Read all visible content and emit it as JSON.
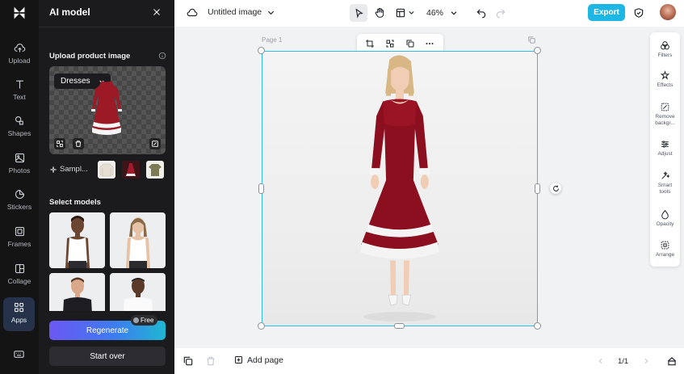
{
  "rail": {
    "items": [
      {
        "label": "Upload",
        "icon": "cloud-upload-icon"
      },
      {
        "label": "Text",
        "icon": "text-icon"
      },
      {
        "label": "Shapes",
        "icon": "shapes-icon"
      },
      {
        "label": "Photos",
        "icon": "photos-icon"
      },
      {
        "label": "Stickers",
        "icon": "stickers-icon"
      },
      {
        "label": "Frames",
        "icon": "frames-icon"
      },
      {
        "label": "Collage",
        "icon": "collage-icon"
      },
      {
        "label": "Apps",
        "icon": "apps-icon",
        "active": true
      }
    ]
  },
  "panel": {
    "title": "AI model",
    "upload_label": "Upload product image",
    "category_select": "Dresses",
    "samples_label": "Sampl...",
    "models_label": "Select models",
    "regenerate_label": "Regenerate",
    "free_badge": "Free",
    "start_over_label": "Start over"
  },
  "topbar": {
    "doc_title": "Untitled image",
    "zoom": "46%",
    "export_label": "Export"
  },
  "canvas": {
    "page_label": "Page 1"
  },
  "right_tools": [
    {
      "label": "Filters",
      "icon": "filters-icon"
    },
    {
      "label": "Effects",
      "icon": "effects-icon"
    },
    {
      "label": "Remove",
      "label2": "backgr...",
      "icon": "remove-background-icon"
    },
    {
      "label": "Adjust",
      "icon": "adjust-icon"
    },
    {
      "label": "Smart",
      "label2": "tools",
      "icon": "smart-tools-icon"
    },
    {
      "label": "Opacity",
      "icon": "opacity-icon"
    },
    {
      "label": "Arrange",
      "icon": "arrange-icon"
    }
  ],
  "bottombar": {
    "add_page_label": "Add page",
    "pager": "1/1"
  },
  "colors": {
    "accent": "#1eb6e3",
    "selection": "#2fbde3",
    "panel_bg": "#1b1b1d",
    "rail_bg": "#141414",
    "dress_red": "#8b0f1f"
  }
}
